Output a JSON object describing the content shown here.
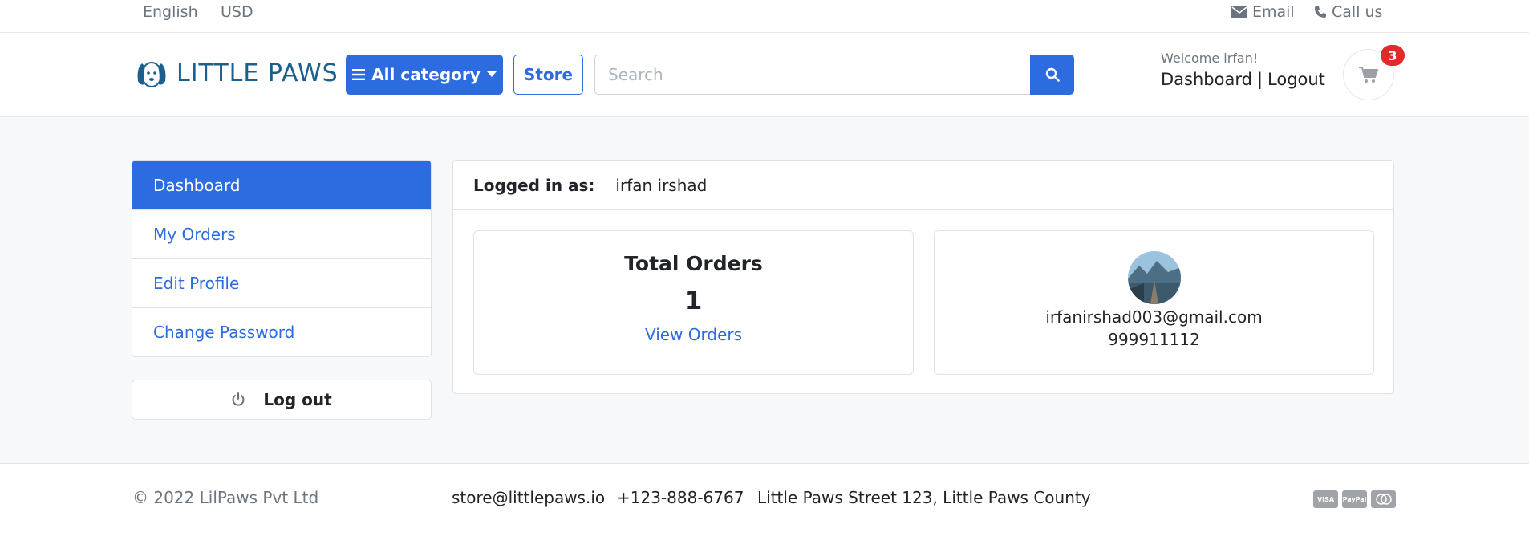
{
  "topbar": {
    "language": "English",
    "currency": "USD",
    "email_label": "Email",
    "call_label": "Call us"
  },
  "header": {
    "brand": "LITTLE PAWS",
    "category_label": "All category",
    "store_label": "Store",
    "search_placeholder": "Search",
    "welcome": "Welcome irfan!",
    "dashboard_link": "Dashboard",
    "separator": "|",
    "logout_link": "Logout",
    "cart_count": "3"
  },
  "sidebar": {
    "items": [
      {
        "label": "Dashboard",
        "active": true
      },
      {
        "label": "My Orders"
      },
      {
        "label": "Edit Profile"
      },
      {
        "label": "Change Password"
      }
    ],
    "logout_label": "Log out"
  },
  "panel": {
    "logged_in_label": "Logged in as:",
    "user_name": "irfan irshad",
    "orders_card": {
      "title": "Total Orders",
      "count": "1",
      "link": "View Orders"
    },
    "profile_card": {
      "email": "irfanirshad003@gmail.com",
      "phone": "999911112"
    }
  },
  "footer": {
    "copyright": "© 2022 LilPaws Pvt Ltd",
    "email": "store@littlepaws.io",
    "phone": "+123-888-6767",
    "address": "Little Paws Street 123, Little Paws County",
    "payment_icons": [
      "visa-icon",
      "paypal-icon",
      "mastercard-icon"
    ]
  },
  "colors": {
    "primary": "#2c6be0",
    "badge": "#e12a2a",
    "brand": "#1b5f8c"
  }
}
